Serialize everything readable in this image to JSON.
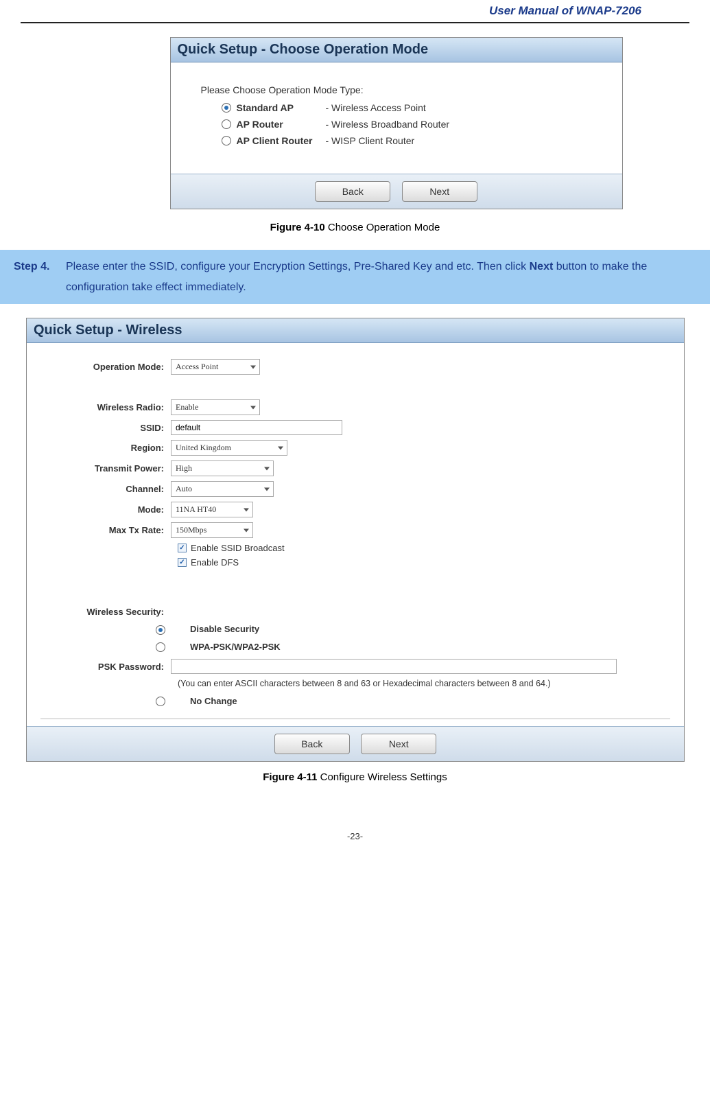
{
  "header": {
    "title": "User Manual of WNAP-7206"
  },
  "figure1": {
    "panel_title": "Quick Setup - Choose Operation Mode",
    "prompt": "Please Choose Operation Mode Type:",
    "options": [
      {
        "name": "Standard AP",
        "desc": "- Wireless Access Point",
        "checked": true
      },
      {
        "name": "AP Router",
        "desc": "- Wireless Broadband Router",
        "checked": false
      },
      {
        "name": "AP Client Router",
        "desc": "- WISP Client Router",
        "checked": false
      }
    ],
    "back_label": "Back",
    "next_label": "Next",
    "caption_bold": "Figure 4-10",
    "caption_rest": " Choose Operation Mode"
  },
  "step4": {
    "label": "Step 4.",
    "text_before": "Please enter the SSID, configure your Encryption Settings, Pre-Shared Key and etc. Then click ",
    "bold_word": "Next",
    "text_after": " button to make the configuration take effect immediately."
  },
  "figure2": {
    "panel_title": "Quick Setup - Wireless",
    "fields": {
      "operation_mode_label": "Operation Mode:",
      "operation_mode_value": "Access Point",
      "wireless_radio_label": "Wireless Radio:",
      "wireless_radio_value": "Enable",
      "ssid_label": "SSID:",
      "ssid_value": "default",
      "region_label": "Region:",
      "region_value": "United Kingdom",
      "transmit_power_label": "Transmit Power:",
      "transmit_power_value": "High",
      "channel_label": "Channel:",
      "channel_value": "Auto",
      "mode_label": "Mode:",
      "mode_value": "11NA HT40",
      "max_tx_rate_label": "Max Tx Rate:",
      "max_tx_rate_value": "150Mbps",
      "chk1_label": "Enable SSID Broadcast",
      "chk2_label": "Enable DFS"
    },
    "security": {
      "heading": "Wireless Security:",
      "opt_disable": "Disable Security",
      "opt_wpa": "WPA-PSK/WPA2-PSK",
      "psk_label": "PSK Password:",
      "psk_value": "",
      "psk_hint": "(You can enter ASCII characters between 8 and 63 or Hexadecimal characters between 8 and 64.)",
      "opt_nochange": "No Change"
    },
    "back_label": "Back",
    "next_label": "Next",
    "caption_bold": "Figure 4-11",
    "caption_rest": " Configure Wireless Settings"
  },
  "footer": {
    "page_number": "-23-"
  }
}
